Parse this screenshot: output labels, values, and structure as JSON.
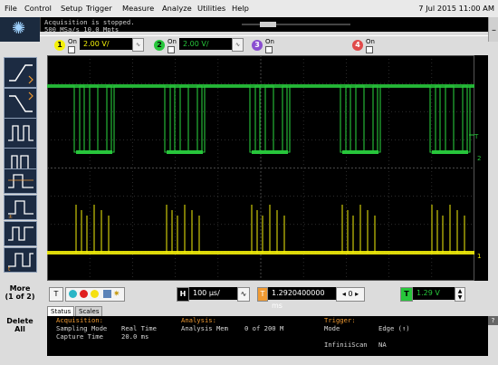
{
  "menu": {
    "items": [
      "File",
      "Control",
      "Setup",
      "Trigger",
      "Measure",
      "Analyze",
      "Utilities",
      "Help"
    ],
    "datetime": "7 Jul 2015 11:00 AM"
  },
  "acquisition_banner": {
    "line1": "Acquisition is stopped.",
    "line2": "500 MSa/s    10.0 Mpts"
  },
  "channels": [
    {
      "num": "1",
      "on_label": "On",
      "scale": "2.00 V/",
      "color": "#f5f10a",
      "checked": true
    },
    {
      "num": "2",
      "on_label": "On",
      "scale": "2.00 V/",
      "color": "#27c63b",
      "checked": true
    },
    {
      "num": "3",
      "on_label": "On",
      "scale": "",
      "color": "#8a4dd0",
      "checked": false
    },
    {
      "num": "4",
      "on_label": "On",
      "scale": "",
      "color": "#e04a4a",
      "checked": false
    }
  ],
  "left_panel": {
    "more_line1": "More",
    "more_line2": "(1 of 2)",
    "delete_line1": "Delete",
    "delete_line2": "All"
  },
  "bottom_bar": {
    "h_label": "H",
    "timebase": "100 µs/",
    "delay_label": "T",
    "delay": "1.2920400000 ms",
    "delay_step": "0",
    "trig_label": "T",
    "trig_level": "1.29 V"
  },
  "tabs": [
    "Status",
    "Scales"
  ],
  "status": {
    "acq_header": "Acquisition:",
    "acq_rows": [
      {
        "k": "Sampling Mode",
        "v": "Real Time"
      },
      {
        "k": "Capture Time",
        "v": "20.0 ms"
      }
    ],
    "ana_header": "Analysis:",
    "ana_rows": [
      {
        "k": "Analysis Mem",
        "v": "0 of 200 M"
      }
    ],
    "trg_header": "Trigger:",
    "trg_rows": [
      {
        "k": "Mode",
        "v": "Edge (↑)"
      },
      {
        "k": "InfiniiScan",
        "v": "NA"
      }
    ]
  },
  "help_label": "?",
  "right_markers": {
    "ch2": "2",
    "ch1": "1",
    "trig": "T"
  },
  "colors": {
    "ch1": "#f5f10a",
    "ch2": "#27c63b",
    "accent": "#f09a32",
    "scope_bg": "#000000"
  }
}
